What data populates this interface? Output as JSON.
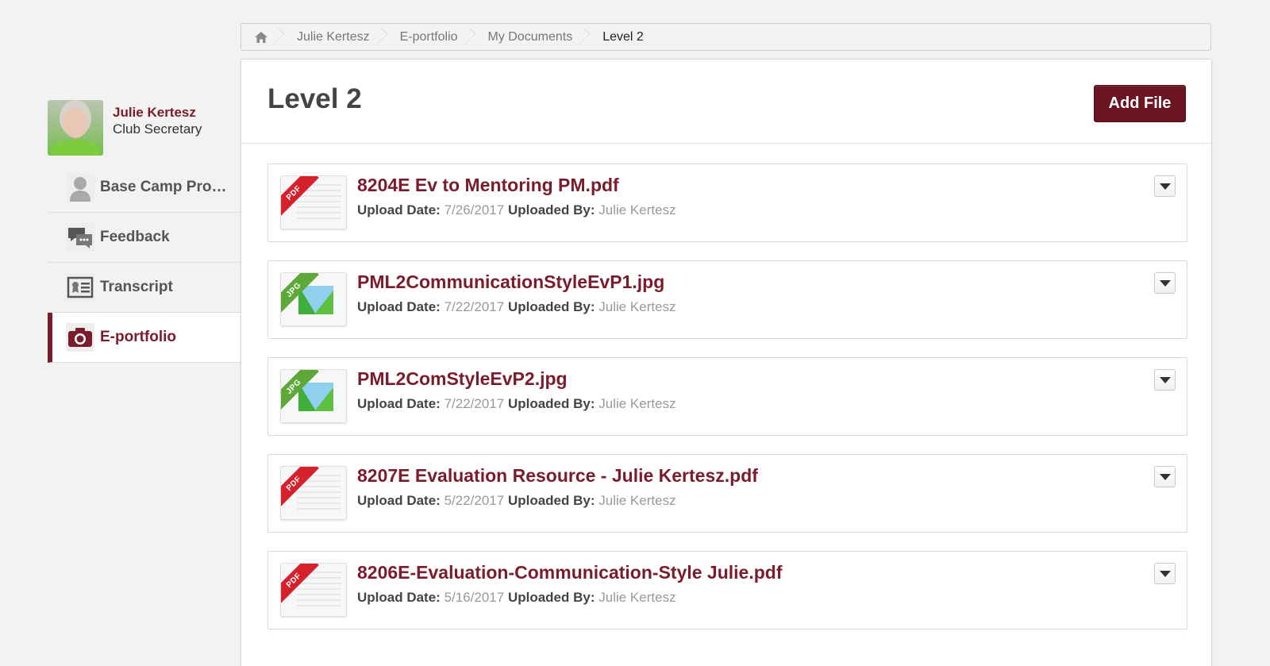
{
  "breadcrumb": {
    "items": [
      "Julie Kertesz",
      "E-portfolio",
      "My Documents"
    ],
    "current": "Level 2"
  },
  "profile": {
    "name": "Julie Kertesz",
    "role": "Club Secretary"
  },
  "sidebar": {
    "items": [
      {
        "label": "Base Camp Pro…",
        "icon": "person-icon",
        "active": false
      },
      {
        "label": "Feedback",
        "icon": "chat-bubbles-icon",
        "active": false
      },
      {
        "label": "Transcript",
        "icon": "certificate-icon",
        "active": false
      },
      {
        "label": "E-portfolio",
        "icon": "camera-icon",
        "active": true
      }
    ]
  },
  "main": {
    "title": "Level 2",
    "add_file_label": "Add File",
    "upload_date_label": "Upload Date:",
    "uploaded_by_label": "Uploaded By:",
    "files": [
      {
        "name": "8204E Ev to Mentoring PM.pdf",
        "type": "PDF",
        "upload_date": "7/26/2017",
        "uploaded_by": "Julie Kertesz"
      },
      {
        "name": "PML2CommunicationStyleEvP1.jpg",
        "type": "JPG",
        "upload_date": "7/22/2017",
        "uploaded_by": "Julie Kertesz"
      },
      {
        "name": "PML2ComStyleEvP2.jpg",
        "type": "JPG",
        "upload_date": "7/22/2017",
        "uploaded_by": "Julie Kertesz"
      },
      {
        "name": "8207E Evaluation Resource - Julie Kertesz.pdf",
        "type": "PDF",
        "upload_date": "5/22/2017",
        "uploaded_by": "Julie Kertesz"
      },
      {
        "name": "8206E-Evaluation-Communication-Style Julie.pdf",
        "type": "PDF",
        "upload_date": "5/16/2017",
        "uploaded_by": "Julie Kertesz"
      }
    ]
  },
  "colors": {
    "accent": "#7a1c2b",
    "button": "#6b1523",
    "pdf_ribbon": "#d6202b",
    "jpg_ribbon": "#5ea83a"
  }
}
